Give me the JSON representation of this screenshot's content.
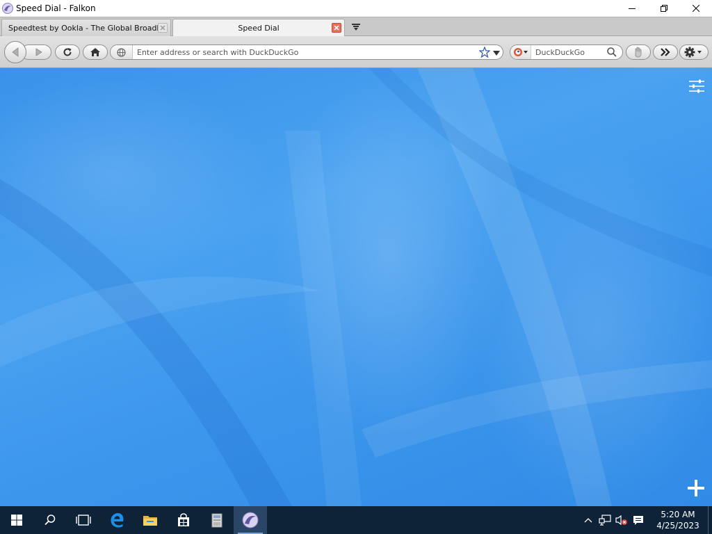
{
  "window": {
    "title": "Speed Dial - Falkon"
  },
  "tabs": [
    {
      "label": "Speedtest by Ookla - The Global Broadban...",
      "active": false
    },
    {
      "label": "Speed Dial",
      "active": true
    }
  ],
  "toolbar": {
    "address_placeholder": "Enter address or search with DuckDuckGo",
    "search_placeholder": "DuckDuckGo"
  },
  "taskbar": {
    "time": "5:20 AM",
    "date": "4/25/2023"
  },
  "colors": {
    "content_blue": "#3a93ea",
    "taskbar_bg": "#0e2238",
    "active_tab_close": "#e9705a"
  }
}
